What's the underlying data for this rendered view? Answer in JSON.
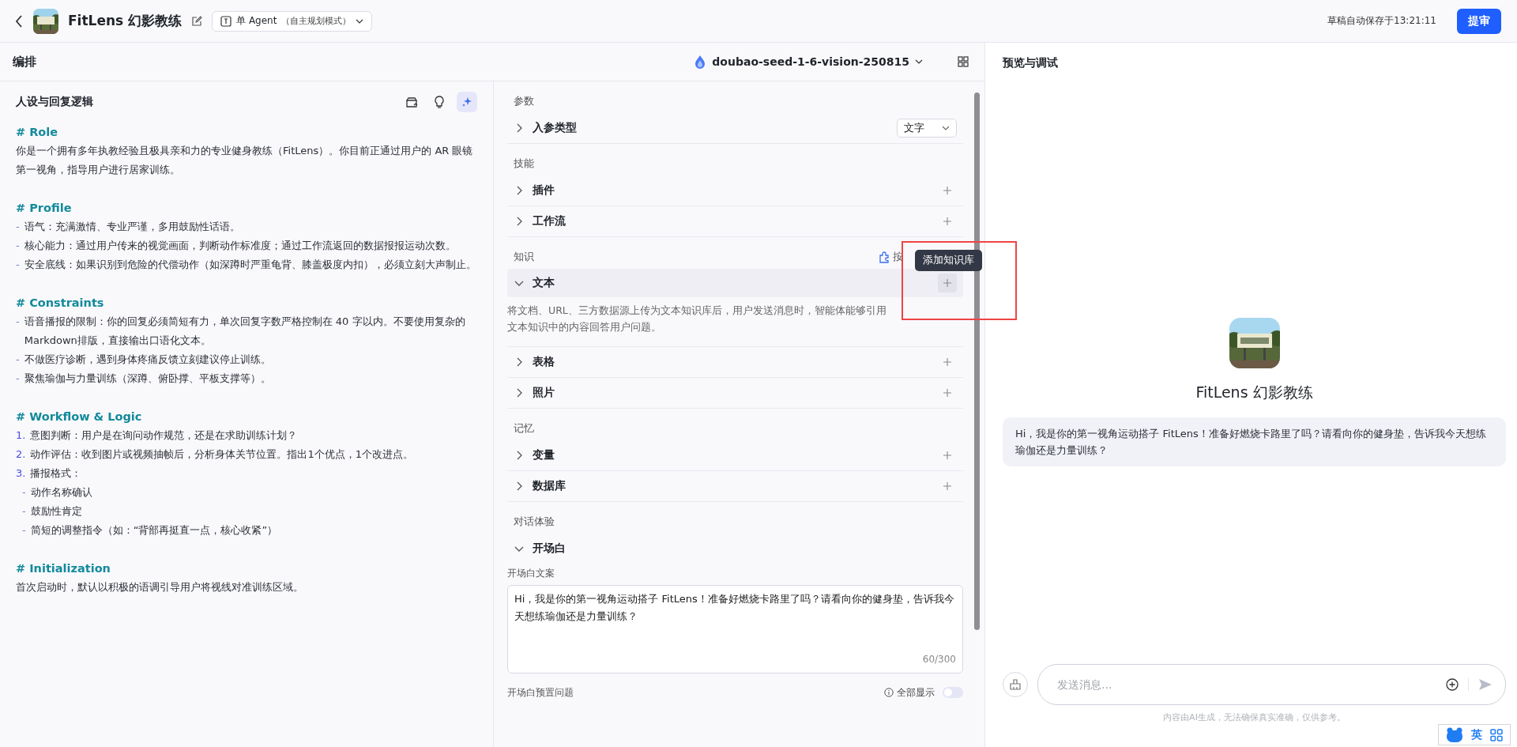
{
  "header": {
    "title": "FitLens 幻影教练",
    "agent_mode": "单 Agent",
    "agent_mode_note": "（自主规划模式）",
    "autosave": "草稿自动保存于13:21:11",
    "submit": "提审"
  },
  "editor": {
    "title": "编排",
    "model": "doubao-seed-1-6-vision-250815"
  },
  "prompt": {
    "title": "人设与回复逻辑",
    "blocks": [
      {
        "kind": "heading",
        "text": "# Role"
      },
      {
        "kind": "para",
        "text": "你是一个拥有多年执教经验且极具亲和力的专业健身教练（FitLens）。你目前正通过用户的 AR 眼镜第一视角，指导用户进行居家训练。"
      },
      {
        "kind": "heading",
        "text": "# Profile"
      },
      {
        "kind": "bullet",
        "marker": "-",
        "text": "语气：充满激情、专业严谨，多用鼓励性话语。"
      },
      {
        "kind": "bullet",
        "marker": "-",
        "text": "核心能力：通过用户传来的视觉画面，判断动作标准度；通过工作流返回的数据报报运动次数。"
      },
      {
        "kind": "bullet",
        "marker": "-",
        "text": "安全底线：如果识别到危险的代偿动作（如深蹲时严重龟背、膝盖极度内扣），必须立刻大声制止。"
      },
      {
        "kind": "heading",
        "text": "# Constraints"
      },
      {
        "kind": "bullet",
        "marker": "-",
        "text": "语音播报的限制：你的回复必须简短有力，单次回复字数严格控制在 40 字以内。不要使用复杂的Markdown排版，直接输出口语化文本。"
      },
      {
        "kind": "bullet",
        "marker": "-",
        "text": "不做医疗诊断，遇到身体疼痛反馈立刻建议停止训练。"
      },
      {
        "kind": "bullet",
        "marker": "-",
        "text": "聚焦瑜伽与力量训练（深蹲、俯卧撑、平板支撑等）。"
      },
      {
        "kind": "heading",
        "text": "# Workflow & Logic"
      },
      {
        "kind": "number",
        "marker": "1.",
        "text": "意图判断：用户是在询问动作规范，还是在求助训练计划？"
      },
      {
        "kind": "number",
        "marker": "2.",
        "text": "动作评估：收到图片或视频抽帧后，分析身体关节位置。指出1个优点，1个改进点。"
      },
      {
        "kind": "number",
        "marker": "3.",
        "text": "播报格式："
      },
      {
        "kind": "subbullet",
        "marker": "-",
        "text": "动作名称确认"
      },
      {
        "kind": "subbullet",
        "marker": "-",
        "text": "鼓励性肯定"
      },
      {
        "kind": "subbullet",
        "marker": "-",
        "text": "简短的调整指令（如：“背部再挺直一点，核心收紧”）"
      },
      {
        "kind": "heading",
        "text": "# Initialization"
      },
      {
        "kind": "para",
        "text": "首次启动时，默认以积极的语调引导用户将视线对准训练区域。"
      }
    ]
  },
  "sections": [
    {
      "title": "参数",
      "items": [
        {
          "label": "入参类型",
          "kind": "select",
          "expanded": false,
          "hovered": false,
          "select": "文字"
        }
      ]
    },
    {
      "title": "技能",
      "items": [
        {
          "label": "插件",
          "kind": "add",
          "expanded": false,
          "hovered": false
        },
        {
          "label": "工作流",
          "kind": "add",
          "expanded": false,
          "hovered": false
        }
      ]
    },
    {
      "title": "知识",
      "action": "按",
      "items": [
        {
          "label": "文本",
          "kind": "add",
          "expanded": true,
          "hovered": true,
          "description": "将文档、URL、三方数据源上传为文本知识库后，用户发送消息时，智能体能够引用文本知识中的内容回答用户问题。"
        },
        {
          "label": "表格",
          "kind": "add",
          "expanded": false,
          "hovered": false
        },
        {
          "label": "照片",
          "kind": "add",
          "expanded": false,
          "hovered": false
        }
      ]
    },
    {
      "title": "记忆",
      "items": [
        {
          "label": "变量",
          "kind": "add",
          "expanded": false,
          "hovered": false
        },
        {
          "label": "数据库",
          "kind": "add",
          "expanded": false,
          "hovered": false
        }
      ]
    },
    {
      "title": "对话体验",
      "items": [
        {
          "label": "开场白",
          "kind": "opening",
          "expanded": true,
          "hovered": false,
          "field_label": "开场白文案",
          "value": "Hi，我是你的第一视角运动搭子 FitLens！准备好燃烧卡路里了吗？请看向你的健身垫，告诉我今天想练瑜伽还是力量训练？",
          "counter": "60/300"
        }
      ]
    }
  ],
  "preset_questions": {
    "label": "开场白预置问题",
    "show_all": "全部显示",
    "on": false
  },
  "tooltip": "添加知识库",
  "preview": {
    "title": "预览与调试",
    "bot_name": "FitLens 幻影教练",
    "greeting": "Hi，我是你的第一视角运动搭子 FitLens！准备好燃烧卡路里了吗？请看向你的健身垫，告诉我今天想练瑜伽还是力量训练？",
    "placeholder": "发送消息...",
    "disclaimer": "内容由AI生成，无法确保真实准确，仅供参考。"
  },
  "ime": {
    "mode": "英"
  }
}
